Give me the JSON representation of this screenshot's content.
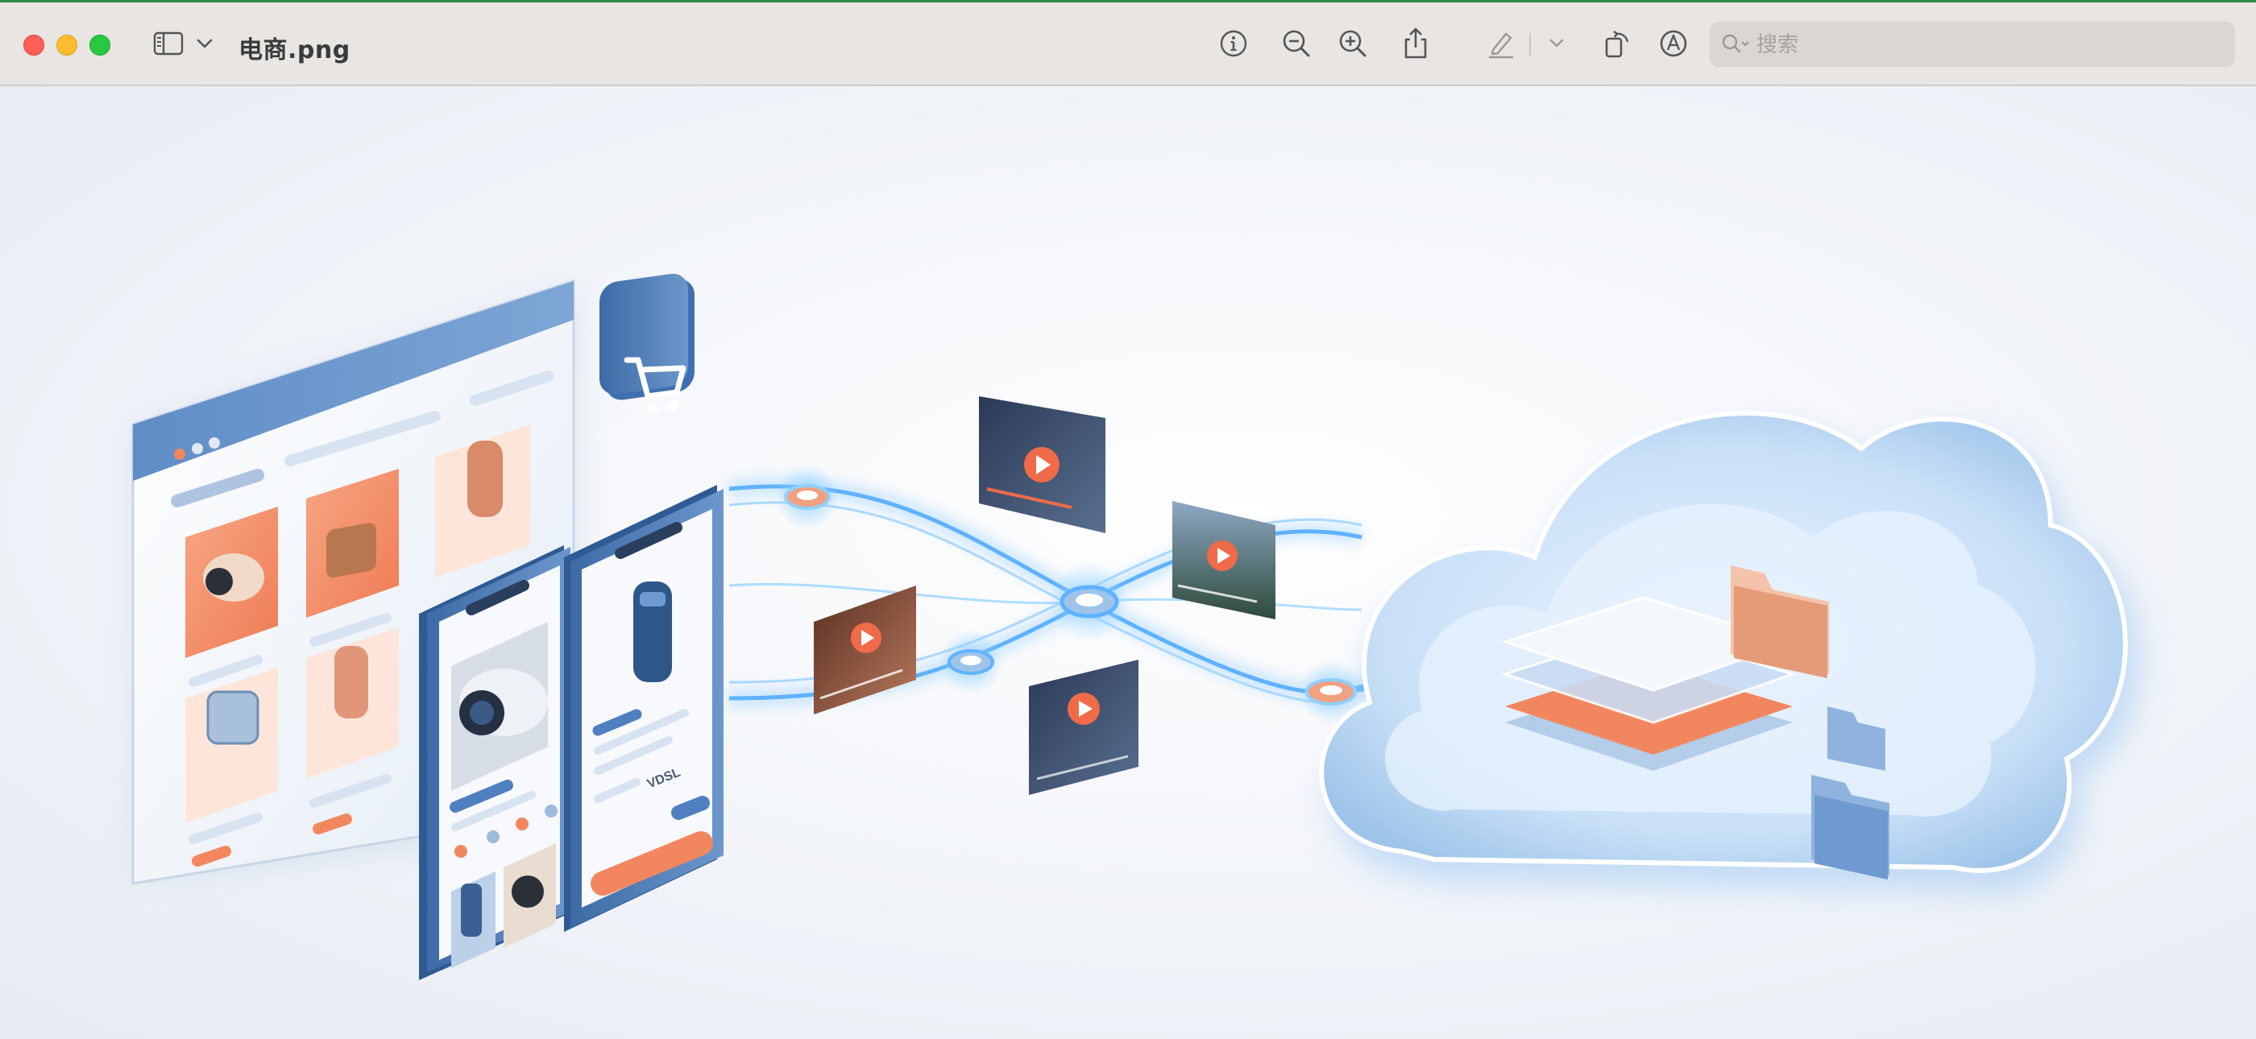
{
  "window": {
    "title": "电商.png",
    "buttons": {
      "close": "close",
      "minimize": "minimize",
      "maximize": "maximize"
    }
  },
  "toolbar": {
    "sidebar_toggle_icon": "sidebar-icon",
    "sidebar_menu_icon": "chevron-down-icon",
    "actions": [
      {
        "icon": "info-icon"
      },
      {
        "icon": "zoom-out-icon"
      },
      {
        "icon": "zoom-in-icon"
      },
      {
        "icon": "share-icon"
      },
      {
        "icon": "highlight-pen-icon"
      },
      {
        "icon": "chevron-down-icon"
      },
      {
        "icon": "rotate-icon"
      },
      {
        "icon": "markup-icon"
      }
    ],
    "search": {
      "placeholder": "搜索",
      "value": ""
    }
  },
  "illustration": {
    "phone_price_label": "VDSL",
    "colors": {
      "accent_orange": "#f2875f",
      "brand_blue": "#4f7fc0",
      "glow_blue": "#64b7ff",
      "cloud_blue": "#bcd7f3"
    }
  }
}
